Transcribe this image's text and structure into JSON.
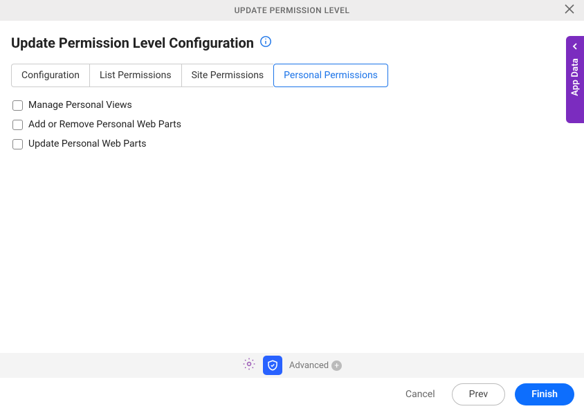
{
  "header": {
    "title": "UPDATE PERMISSION LEVEL"
  },
  "page": {
    "title": "Update Permission Level Configuration"
  },
  "tabs": [
    {
      "label": "Configuration",
      "active": false
    },
    {
      "label": "List Permissions",
      "active": false
    },
    {
      "label": "Site Permissions",
      "active": false
    },
    {
      "label": "Personal Permissions",
      "active": true
    }
  ],
  "permissions": [
    {
      "label": "Manage Personal Views",
      "checked": false
    },
    {
      "label": "Add or Remove Personal Web Parts",
      "checked": false
    },
    {
      "label": "Update Personal Web Parts",
      "checked": false
    }
  ],
  "sidePanel": {
    "label": "App Data"
  },
  "toolbar": {
    "advanced_label": "Advanced"
  },
  "footer": {
    "cancel_label": "Cancel",
    "prev_label": "Prev",
    "finish_label": "Finish"
  }
}
